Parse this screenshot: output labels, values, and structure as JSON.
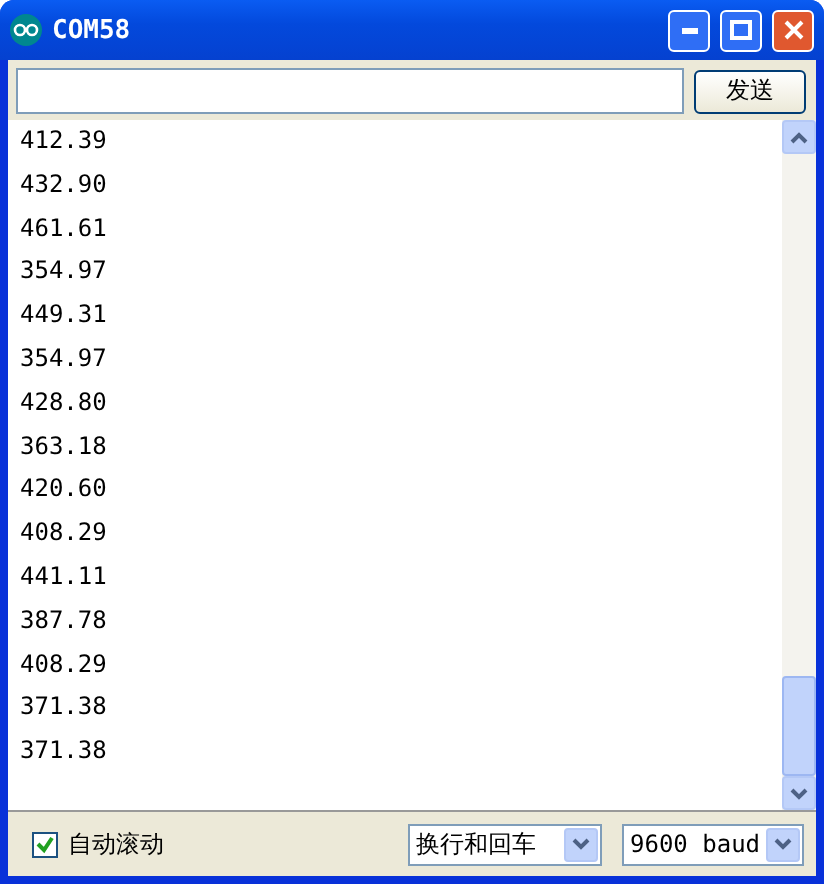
{
  "window": {
    "title": "COM58"
  },
  "send_button": {
    "label": "发送"
  },
  "output_lines": [
    "412.39",
    "432.90",
    "461.61",
    "354.97",
    "449.31",
    "354.97",
    "428.80",
    "363.18",
    "420.60",
    "408.29",
    "441.11",
    "387.78",
    "408.29",
    "371.38",
    "371.38"
  ],
  "autoscroll": {
    "label": "自动滚动",
    "checked": true
  },
  "line_ending": {
    "value": "换行和回车"
  },
  "baud_rate": {
    "value": "9600 baud"
  }
}
